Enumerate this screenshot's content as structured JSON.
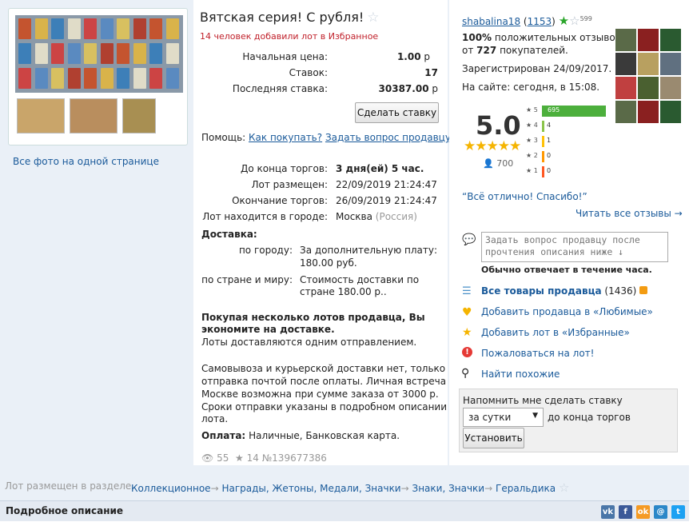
{
  "lot": {
    "title": "Вятская серия! С рубля!",
    "fav_text": "14 человек добавили лот в Избранное",
    "start_price_label": "Начальная цена:",
    "start_price": "1.00",
    "bids_label": "Ставок:",
    "bids": "17",
    "last_bid_label": "Последняя ставка:",
    "last_bid": "30387.00",
    "currency": "р",
    "bid_button": "Сделать ставку",
    "help_label": "Помощь:",
    "help_how_to_buy": "Как покупать?",
    "help_ask_seller": "Задать вопрос продавцу",
    "ends_in_label": "До конца торгов:",
    "ends_in": "3 дня(ей) 5 час.",
    "placed_label": "Лот размещен:",
    "placed": "22/09/2019 21:24:47",
    "end_label": "Окончание торгов:",
    "end": "26/09/2019 21:24:47",
    "city_label": "Лот находится в городе:",
    "city": "Москва",
    "country": "(Россия)",
    "delivery_label": "Доставка:",
    "by_city_label": "по городу:",
    "by_city_value": "За дополнительную плату:",
    "by_city_price": "180.00 руб.",
    "by_world_label": "по стране и миру:",
    "by_world_value": "Стоимость доставки по",
    "by_world_value2": "стране 180.00 р..",
    "promo_1": "Покупая несколько лотов продавца, Вы",
    "promo_2": "экономите на доставке.",
    "promo_3": "Лоты доставляются одним отправлением.",
    "note_1": "Самовывоза и курьерской доставки нет, только",
    "note_2": "отправка почтой после оплаты. Личная встреча в",
    "note_3": "Москве возможна при сумме заказа от 3000 р.",
    "note_4": "Сроки отправки указаны в подробном описании",
    "note_5": "лота.",
    "payment_label": "Оплата:",
    "payment": "Наличные, Банковская карта.",
    "views": "55",
    "stars": "14",
    "lot_number": "№139677386"
  },
  "left": {
    "all_photos": "Все фото на одной странице"
  },
  "seller": {
    "name": "shabalina18",
    "rating_count_open": "(",
    "rating_count": "1153",
    "rating_count_close": ")",
    "badge_num": "599",
    "positive_pct": "100%",
    "positive_text": "положительных отзывов",
    "from_text": "от",
    "buyers": "727",
    "buyers_text": "покупателей.",
    "registered": "Зарегистрирован 24/09/2017.",
    "online": "На сайте: сегодня, в 15:08.",
    "score": "5.0",
    "reviews": "700",
    "dist": [
      {
        "stars": "5",
        "count": "695",
        "color": "#4caf3c",
        "share": 1.0
      },
      {
        "stars": "4",
        "count": "4",
        "color": "#8bc34a",
        "share": 0.006
      },
      {
        "stars": "3",
        "count": "1",
        "color": "#ffc107",
        "share": 0.002
      },
      {
        "stars": "2",
        "count": "0",
        "color": "#ff9800",
        "share": 0.0
      },
      {
        "stars": "1",
        "count": "0",
        "color": "#ff5722",
        "share": 0.0
      }
    ],
    "quote": "“Всё отлично! Спасибо!”",
    "read_all": "Читать все отзывы →",
    "ask_placeholder": "Задать вопрос продавцу после прочтения описания ниже ↓",
    "reply_time": "Обычно отвечает в течение часа.",
    "all_goods": "Все товары продавца",
    "all_goods_count": "(1436)",
    "add_fav_seller": "Добавить продавца в «Любимые»",
    "add_fav_lot": "Добавить лот в «Избранные»",
    "complain": "Пожаловаться на лот!",
    "find_similar": "Найти похожие",
    "remind_title": "Напомнить мне сделать ставку",
    "remind_option": "за сутки",
    "remind_suffix": "до конца торгов",
    "remind_button": "Установить"
  },
  "breadcrumb": {
    "prefix": "Лот размещен в разделе",
    "items": [
      "Коллекционное",
      "Награды, Жетоны, Медали, Значки",
      "Знаки, Значки",
      "Геральдика"
    ],
    "sep": "→"
  },
  "section": {
    "title": "Подробное описание"
  },
  "social": [
    "vk",
    "f",
    "ok",
    "mail",
    "tw"
  ],
  "colors": {
    "link": "#1a5a9a",
    "favcount": "#c0202a",
    "green_star": "#2aa52a",
    "gold_star": "#f5b400",
    "complain": "#e53935"
  }
}
